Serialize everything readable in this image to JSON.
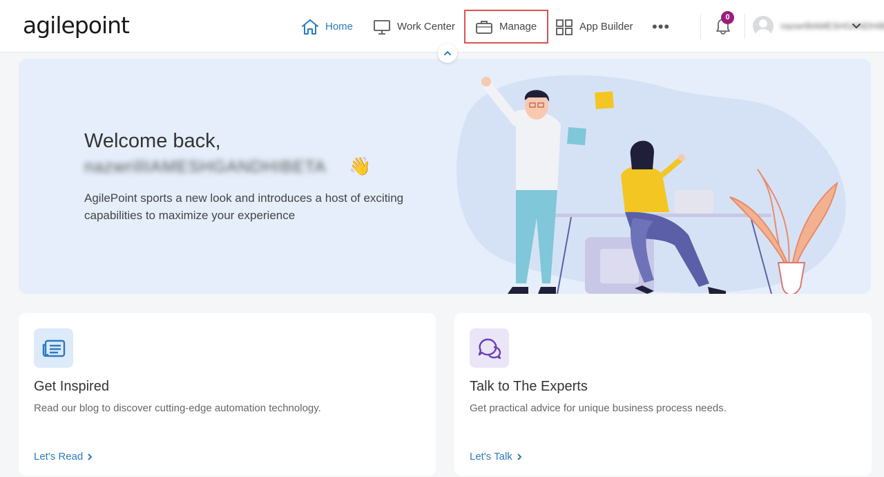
{
  "header": {
    "logo": "agilepoint",
    "nav": [
      {
        "label": "Home",
        "icon": "home-icon"
      },
      {
        "label": "Work Center",
        "icon": "monitor-icon"
      },
      {
        "label": "Manage",
        "icon": "briefcase-icon"
      },
      {
        "label": "App Builder",
        "icon": "grid-icon"
      }
    ],
    "more": "•••",
    "notifications": {
      "count": "0",
      "icon": "bell-icon"
    },
    "user": {
      "name": "nazwrillIAMESHGANDHIBETA",
      "icon": "avatar-icon"
    }
  },
  "hero": {
    "title": "Welcome back,",
    "name": "nazwrillIAMESHGANDHIBETA",
    "emoji": "👋",
    "description": "AgilePoint sports a new look and introduces a host of exciting capabilities to maximize your experience"
  },
  "cards": [
    {
      "title": "Get Inspired",
      "description": "Read our blog to discover cutting-edge automation technology.",
      "link": "Let's Read",
      "icon": "newspaper-icon"
    },
    {
      "title": "Talk to The Experts",
      "description": "Get practical advice for unique business process needs.",
      "link": "Let's Talk",
      "icon": "chat-bubbles-icon"
    }
  ],
  "colors": {
    "accent": "#2a7bc0",
    "highlight_border": "#d9534f",
    "badge": "#9b1f7a",
    "hero_bg": "#e5eefa"
  }
}
